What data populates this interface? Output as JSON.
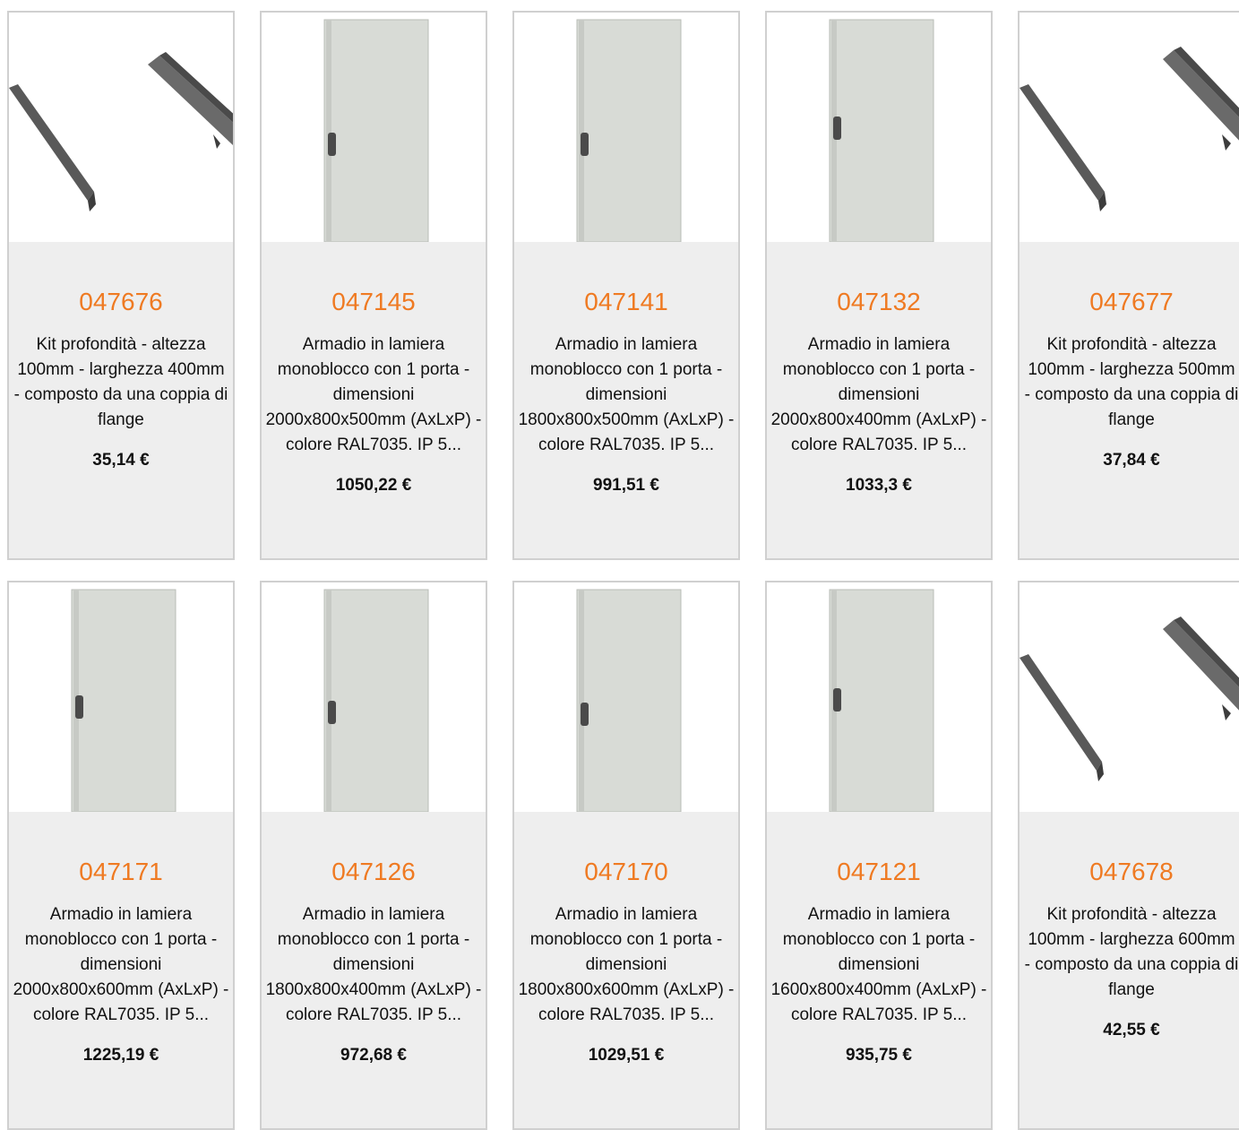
{
  "products": [
    {
      "code": "047676",
      "desc": "Kit profondità - altezza 100mm - larghezza 400mm - composto da una coppia di flange",
      "price": "35,14 €",
      "image": "flange-rails-icon"
    },
    {
      "code": "047145",
      "desc": "Armadio in lamiera monoblocco con 1 porta - dimensioni 2000x800x500mm (AxLxP) - colore RAL7035. IP 5...",
      "price": "1050,22 €",
      "image": "cabinet-icon"
    },
    {
      "code": "047141",
      "desc": "Armadio in lamiera monoblocco con 1 porta - dimensioni 1800x800x500mm (AxLxP) - colore RAL7035. IP 5...",
      "price": "991,51 €",
      "image": "cabinet-icon"
    },
    {
      "code": "047132",
      "desc": "Armadio in lamiera monoblocco con 1 porta - dimensioni 2000x800x400mm (AxLxP) - colore RAL7035. IP 5...",
      "price": "1033,3 €",
      "image": "cabinet-icon"
    },
    {
      "code": "047677",
      "desc": "Kit profondità - altezza 100mm - larghezza 500mm - composto da una coppia di flange",
      "price": "37,84 €",
      "image": "flange-rails-icon"
    },
    {
      "code": "047171",
      "desc": "Armadio in lamiera monoblocco con 1 porta - dimensioni 2000x800x600mm (AxLxP) - colore RAL7035. IP 5...",
      "price": "1225,19 €",
      "image": "cabinet-icon"
    },
    {
      "code": "047126",
      "desc": "Armadio in lamiera monoblocco con 1 porta - dimensioni 1800x800x400mm (AxLxP) - colore RAL7035. IP 5...",
      "price": "972,68 €",
      "image": "cabinet-icon"
    },
    {
      "code": "047170",
      "desc": "Armadio in lamiera monoblocco con 1 porta - dimensioni 1800x800x600mm (AxLxP) - colore RAL7035. IP 5...",
      "price": "1029,51 €",
      "image": "cabinet-icon"
    },
    {
      "code": "047121",
      "desc": "Armadio in lamiera monoblocco con 1 porta - dimensioni 1600x800x400mm (AxLxP) - colore RAL7035. IP 5...",
      "price": "935,75 €",
      "image": "cabinet-icon"
    },
    {
      "code": "047678",
      "desc": "Kit profondità - altezza 100mm - larghezza 600mm - composto da una coppia di flange",
      "price": "42,55 €",
      "image": "flange-rails-icon"
    }
  ],
  "colors": {
    "code": "#ef7a22",
    "card_bg": "#eeeeee",
    "border": "#d0d0d0"
  }
}
